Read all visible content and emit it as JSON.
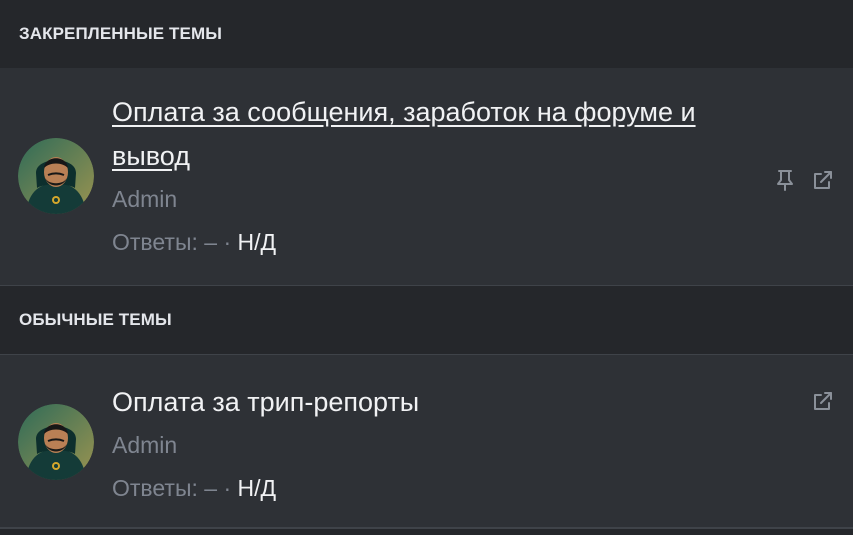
{
  "sections": {
    "pinned": {
      "title": "ЗАКРЕПЛЕННЫЕ ТЕМЫ",
      "thread": {
        "title": "Оплата за сообщения, заработок на форуме и вывод",
        "author": "Admin",
        "replies_label": "Ответы:",
        "replies_value": "–",
        "separator": "·",
        "last_activity": "Н/Д",
        "icons": [
          "pin-icon",
          "external-link-icon"
        ]
      }
    },
    "regular": {
      "title": "ОБЫЧНЫЕ ТЕМЫ",
      "thread": {
        "title": "Оплата за трип-репорты",
        "author": "Admin",
        "replies_label": "Ответы:",
        "replies_value": "–",
        "separator": "·",
        "last_activity": "Н/Д",
        "icons": [
          "external-link-icon"
        ]
      }
    }
  },
  "colors": {
    "background": "#25272b",
    "row_background": "#2e3136",
    "text": "#f1f2f4",
    "muted": "#7f8590",
    "divider": "#3f4349"
  }
}
